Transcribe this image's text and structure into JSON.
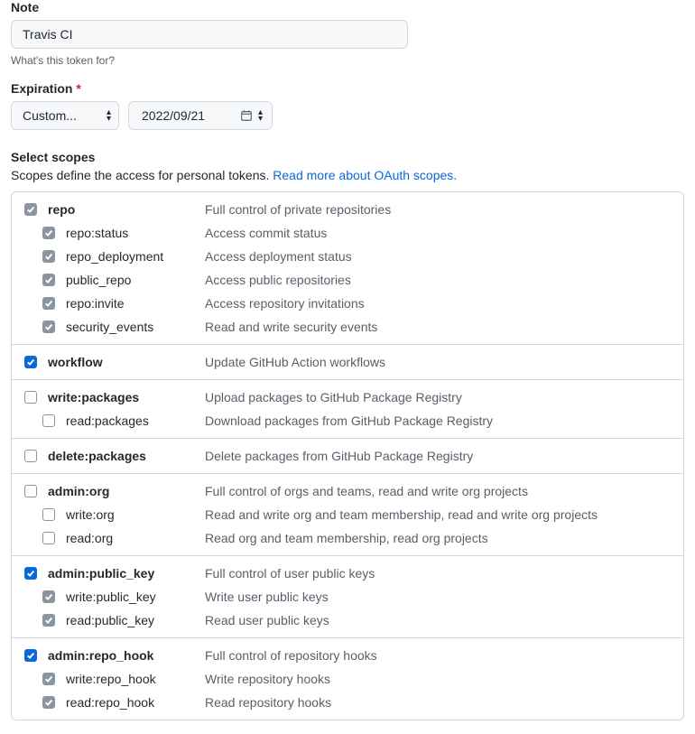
{
  "note": {
    "label": "Note",
    "value": "Travis CI",
    "help": "What's this token for?"
  },
  "expiration": {
    "label": "Expiration",
    "required_mark": "*",
    "mode": "Custom...",
    "date": "2022/09/21"
  },
  "scopes_section": {
    "heading": "Select scopes",
    "description_prefix": "Scopes define the access for personal tokens. ",
    "link_text": "Read more about OAuth scopes."
  },
  "scope_groups": [
    {
      "parent": {
        "name": "repo",
        "desc": "Full control of private repositories",
        "state": "implied"
      },
      "children": [
        {
          "name": "repo:status",
          "desc": "Access commit status",
          "state": "implied"
        },
        {
          "name": "repo_deployment",
          "desc": "Access deployment status",
          "state": "implied"
        },
        {
          "name": "public_repo",
          "desc": "Access public repositories",
          "state": "implied"
        },
        {
          "name": "repo:invite",
          "desc": "Access repository invitations",
          "state": "implied"
        },
        {
          "name": "security_events",
          "desc": "Read and write security events",
          "state": "implied"
        }
      ]
    },
    {
      "parent": {
        "name": "workflow",
        "desc": "Update GitHub Action workflows",
        "state": "checked"
      },
      "children": []
    },
    {
      "parent": {
        "name": "write:packages",
        "desc": "Upload packages to GitHub Package Registry",
        "state": "unchecked"
      },
      "children": [
        {
          "name": "read:packages",
          "desc": "Download packages from GitHub Package Registry",
          "state": "unchecked"
        }
      ]
    },
    {
      "parent": {
        "name": "delete:packages",
        "desc": "Delete packages from GitHub Package Registry",
        "state": "unchecked"
      },
      "children": []
    },
    {
      "parent": {
        "name": "admin:org",
        "desc": "Full control of orgs and teams, read and write org projects",
        "state": "unchecked"
      },
      "children": [
        {
          "name": "write:org",
          "desc": "Read and write org and team membership, read and write org projects",
          "state": "unchecked"
        },
        {
          "name": "read:org",
          "desc": "Read org and team membership, read org projects",
          "state": "unchecked"
        }
      ]
    },
    {
      "parent": {
        "name": "admin:public_key",
        "desc": "Full control of user public keys",
        "state": "checked"
      },
      "children": [
        {
          "name": "write:public_key",
          "desc": "Write user public keys",
          "state": "implied"
        },
        {
          "name": "read:public_key",
          "desc": "Read user public keys",
          "state": "implied"
        }
      ]
    },
    {
      "parent": {
        "name": "admin:repo_hook",
        "desc": "Full control of repository hooks",
        "state": "checked"
      },
      "children": [
        {
          "name": "write:repo_hook",
          "desc": "Write repository hooks",
          "state": "implied"
        },
        {
          "name": "read:repo_hook",
          "desc": "Read repository hooks",
          "state": "implied"
        }
      ]
    }
  ]
}
